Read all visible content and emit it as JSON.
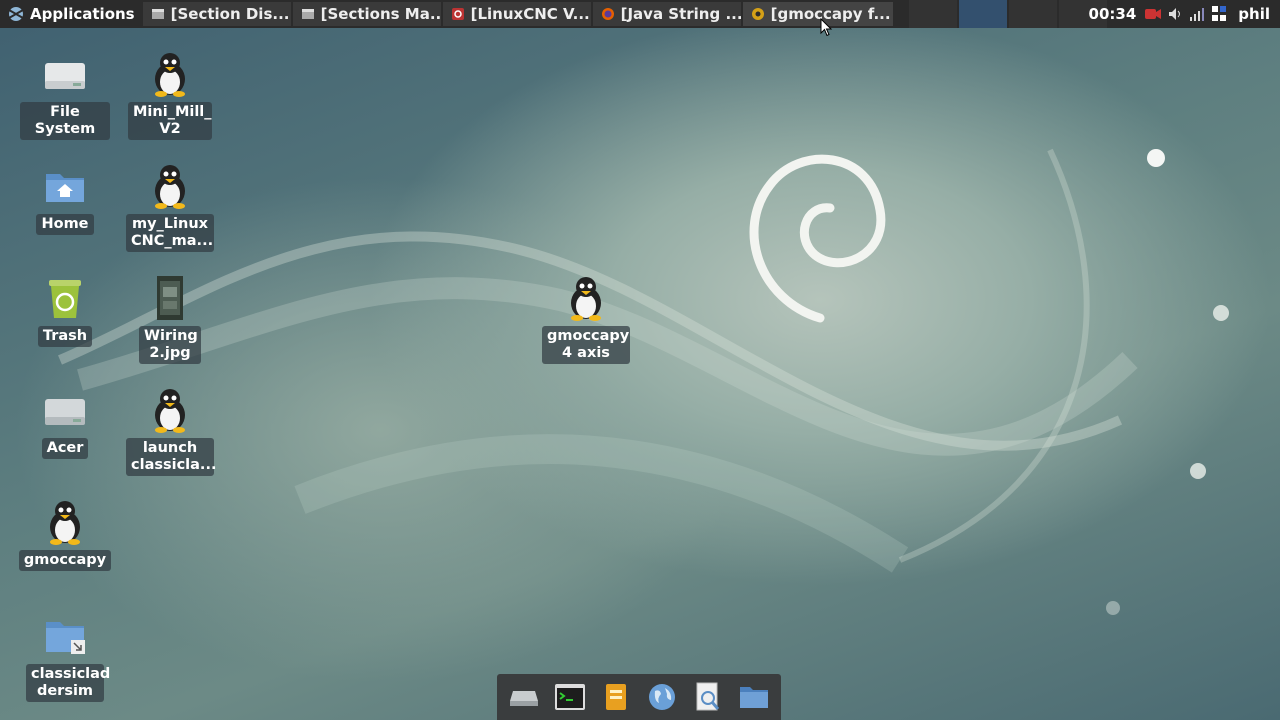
{
  "panel": {
    "applications_label": "Applications",
    "tasks": [
      {
        "label": "[Section Dis...",
        "icon": "window-icon"
      },
      {
        "label": "[Sections Ma...",
        "icon": "window-icon"
      },
      {
        "label": "[LinuxCNC V...",
        "icon": "pdf-icon"
      },
      {
        "label": "[Java String ...",
        "icon": "firefox-icon"
      },
      {
        "label": "[gmoccapy f...",
        "icon": "gmoccapy-icon"
      }
    ],
    "clock": "00:34",
    "user": "phil"
  },
  "desktop": {
    "icons": [
      {
        "label": "File System",
        "icon": "drive-icon"
      },
      {
        "label": "Mini_Mill_ V2",
        "icon": "tux-icon"
      },
      {
        "label": "Home",
        "icon": "home-folder-icon"
      },
      {
        "label": "my_Linux CNC_ma...",
        "icon": "tux-icon"
      },
      {
        "label": "Trash",
        "icon": "trash-icon"
      },
      {
        "label": "Wiring 2.jpg",
        "icon": "image-file-icon"
      },
      {
        "label": "Acer",
        "icon": "drive-icon"
      },
      {
        "label": "launch classicla...",
        "icon": "tux-icon"
      },
      {
        "label": "gmoccapy",
        "icon": "tux-icon"
      },
      {
        "label": "classiclad dersim",
        "icon": "folder-link-icon"
      },
      {
        "label": "gmoccapy 4 axis",
        "icon": "tux-icon"
      }
    ]
  },
  "dock": {
    "items": [
      "drive-icon",
      "terminal-icon",
      "files-icon",
      "browser-icon",
      "search-icon",
      "folder-icon"
    ]
  },
  "colors": {
    "panel_bg": "#2b2b2b",
    "active_workspace": "#33506e",
    "label_bg": "#323c42"
  }
}
